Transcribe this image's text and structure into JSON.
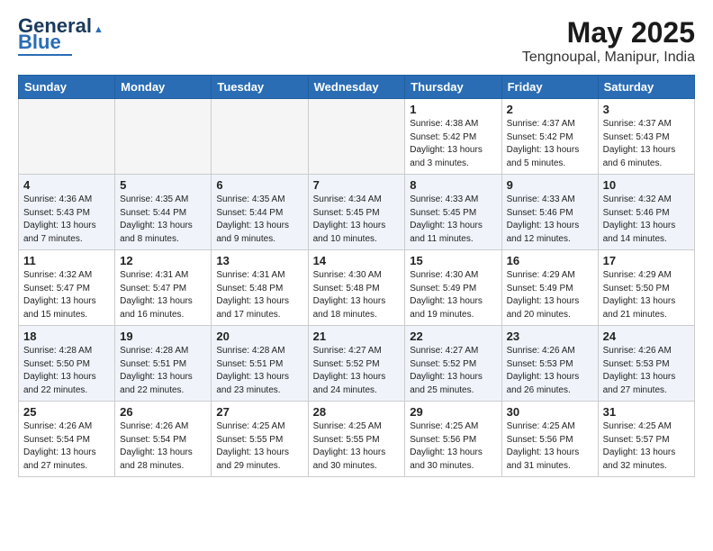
{
  "header": {
    "logo_line1": "General",
    "logo_line2": "Blue",
    "title": "May 2025",
    "subtitle": "Tengnoupal, Manipur, India"
  },
  "columns": [
    "Sunday",
    "Monday",
    "Tuesday",
    "Wednesday",
    "Thursday",
    "Friday",
    "Saturday"
  ],
  "weeks": [
    [
      {
        "num": "",
        "info": ""
      },
      {
        "num": "",
        "info": ""
      },
      {
        "num": "",
        "info": ""
      },
      {
        "num": "",
        "info": ""
      },
      {
        "num": "1",
        "info": "Sunrise: 4:38 AM\nSunset: 5:42 PM\nDaylight: 13 hours\nand 3 minutes."
      },
      {
        "num": "2",
        "info": "Sunrise: 4:37 AM\nSunset: 5:42 PM\nDaylight: 13 hours\nand 5 minutes."
      },
      {
        "num": "3",
        "info": "Sunrise: 4:37 AM\nSunset: 5:43 PM\nDaylight: 13 hours\nand 6 minutes."
      }
    ],
    [
      {
        "num": "4",
        "info": "Sunrise: 4:36 AM\nSunset: 5:43 PM\nDaylight: 13 hours\nand 7 minutes."
      },
      {
        "num": "5",
        "info": "Sunrise: 4:35 AM\nSunset: 5:44 PM\nDaylight: 13 hours\nand 8 minutes."
      },
      {
        "num": "6",
        "info": "Sunrise: 4:35 AM\nSunset: 5:44 PM\nDaylight: 13 hours\nand 9 minutes."
      },
      {
        "num": "7",
        "info": "Sunrise: 4:34 AM\nSunset: 5:45 PM\nDaylight: 13 hours\nand 10 minutes."
      },
      {
        "num": "8",
        "info": "Sunrise: 4:33 AM\nSunset: 5:45 PM\nDaylight: 13 hours\nand 11 minutes."
      },
      {
        "num": "9",
        "info": "Sunrise: 4:33 AM\nSunset: 5:46 PM\nDaylight: 13 hours\nand 12 minutes."
      },
      {
        "num": "10",
        "info": "Sunrise: 4:32 AM\nSunset: 5:46 PM\nDaylight: 13 hours\nand 14 minutes."
      }
    ],
    [
      {
        "num": "11",
        "info": "Sunrise: 4:32 AM\nSunset: 5:47 PM\nDaylight: 13 hours\nand 15 minutes."
      },
      {
        "num": "12",
        "info": "Sunrise: 4:31 AM\nSunset: 5:47 PM\nDaylight: 13 hours\nand 16 minutes."
      },
      {
        "num": "13",
        "info": "Sunrise: 4:31 AM\nSunset: 5:48 PM\nDaylight: 13 hours\nand 17 minutes."
      },
      {
        "num": "14",
        "info": "Sunrise: 4:30 AM\nSunset: 5:48 PM\nDaylight: 13 hours\nand 18 minutes."
      },
      {
        "num": "15",
        "info": "Sunrise: 4:30 AM\nSunset: 5:49 PM\nDaylight: 13 hours\nand 19 minutes."
      },
      {
        "num": "16",
        "info": "Sunrise: 4:29 AM\nSunset: 5:49 PM\nDaylight: 13 hours\nand 20 minutes."
      },
      {
        "num": "17",
        "info": "Sunrise: 4:29 AM\nSunset: 5:50 PM\nDaylight: 13 hours\nand 21 minutes."
      }
    ],
    [
      {
        "num": "18",
        "info": "Sunrise: 4:28 AM\nSunset: 5:50 PM\nDaylight: 13 hours\nand 22 minutes."
      },
      {
        "num": "19",
        "info": "Sunrise: 4:28 AM\nSunset: 5:51 PM\nDaylight: 13 hours\nand 22 minutes."
      },
      {
        "num": "20",
        "info": "Sunrise: 4:28 AM\nSunset: 5:51 PM\nDaylight: 13 hours\nand 23 minutes."
      },
      {
        "num": "21",
        "info": "Sunrise: 4:27 AM\nSunset: 5:52 PM\nDaylight: 13 hours\nand 24 minutes."
      },
      {
        "num": "22",
        "info": "Sunrise: 4:27 AM\nSunset: 5:52 PM\nDaylight: 13 hours\nand 25 minutes."
      },
      {
        "num": "23",
        "info": "Sunrise: 4:26 AM\nSunset: 5:53 PM\nDaylight: 13 hours\nand 26 minutes."
      },
      {
        "num": "24",
        "info": "Sunrise: 4:26 AM\nSunset: 5:53 PM\nDaylight: 13 hours\nand 27 minutes."
      }
    ],
    [
      {
        "num": "25",
        "info": "Sunrise: 4:26 AM\nSunset: 5:54 PM\nDaylight: 13 hours\nand 27 minutes."
      },
      {
        "num": "26",
        "info": "Sunrise: 4:26 AM\nSunset: 5:54 PM\nDaylight: 13 hours\nand 28 minutes."
      },
      {
        "num": "27",
        "info": "Sunrise: 4:25 AM\nSunset: 5:55 PM\nDaylight: 13 hours\nand 29 minutes."
      },
      {
        "num": "28",
        "info": "Sunrise: 4:25 AM\nSunset: 5:55 PM\nDaylight: 13 hours\nand 30 minutes."
      },
      {
        "num": "29",
        "info": "Sunrise: 4:25 AM\nSunset: 5:56 PM\nDaylight: 13 hours\nand 30 minutes."
      },
      {
        "num": "30",
        "info": "Sunrise: 4:25 AM\nSunset: 5:56 PM\nDaylight: 13 hours\nand 31 minutes."
      },
      {
        "num": "31",
        "info": "Sunrise: 4:25 AM\nSunset: 5:57 PM\nDaylight: 13 hours\nand 32 minutes."
      }
    ]
  ]
}
